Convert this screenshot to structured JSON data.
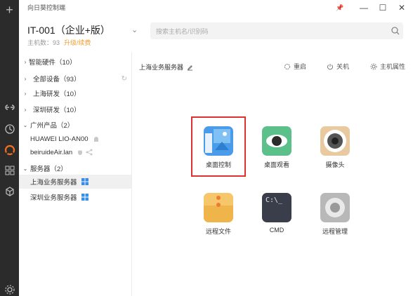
{
  "app": {
    "title": "向日葵控制端"
  },
  "window_controls": {
    "pin": "📌",
    "minimize": "—",
    "maximize": "☐",
    "close": "✕"
  },
  "device": {
    "name": "IT-001（企业+版）",
    "host_count": "主机数：93",
    "upgrade": "升级/续费"
  },
  "search": {
    "placeholder": "搜索主机名/识别码"
  },
  "tree": [
    {
      "label": "智能硬件（10）",
      "arrow": "›"
    },
    {
      "label": "全部设备（93）",
      "arrow": "›"
    },
    {
      "label": "上海研发（10）",
      "arrow": "›"
    },
    {
      "label": "深圳研发（10）",
      "arrow": "›"
    },
    {
      "label": "广州产品（2）",
      "arrow": "⌄"
    },
    {
      "label": "HUAWEI LIO-AN00",
      "arrow": ""
    },
    {
      "label": "beiruideAir.lan",
      "arrow": ""
    },
    {
      "label": "服务器（2）",
      "arrow": "⌄"
    },
    {
      "label": "上海业务服务器",
      "arrow": ""
    },
    {
      "label": "深圳业务服务器",
      "arrow": ""
    }
  ],
  "main": {
    "breadcrumb": "上海业务服务器",
    "actions": {
      "restart": "重启",
      "shutdown": "关机",
      "properties": "主机属性"
    },
    "tiles": [
      {
        "label": "桌面控制"
      },
      {
        "label": "桌面观看"
      },
      {
        "label": "摄像头"
      },
      {
        "label": "远程文件"
      },
      {
        "label": "CMD",
        "icon_text": "C:\\_"
      },
      {
        "label": "远程管理"
      }
    ]
  },
  "colors": {
    "rail": "#2b2b2b",
    "accent": "#f0a030",
    "highlight": "#e03030"
  }
}
